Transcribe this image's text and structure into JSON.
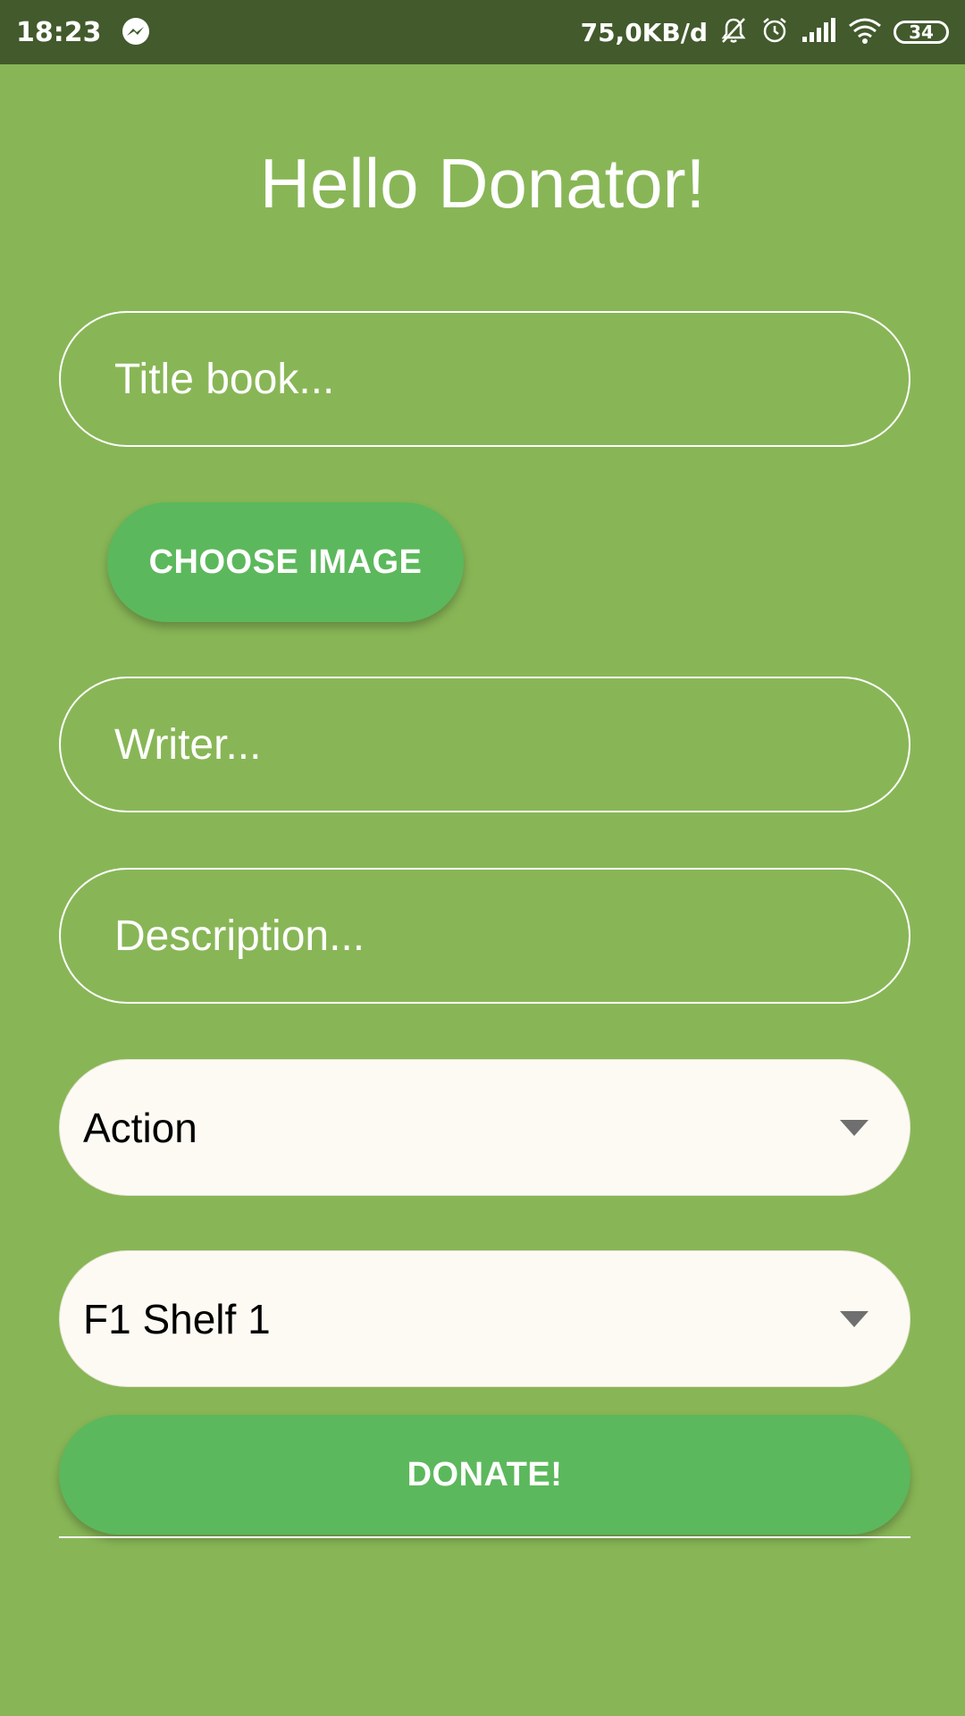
{
  "status_bar": {
    "time": "18:23",
    "net_speed": "75,0KB/d",
    "battery_level": "34",
    "icons": [
      "messenger-icon",
      "mute-icon",
      "alarm-icon",
      "signal-icon",
      "wifi-icon",
      "battery-icon"
    ]
  },
  "header": {
    "title": "Hello Donator!"
  },
  "form": {
    "title_placeholder": "Title book...",
    "choose_image_label": "CHOOSE IMAGE",
    "writer_placeholder": "Writer...",
    "description_placeholder": "Description...",
    "genre_selected": "Action",
    "shelf_selected": "F1 Shelf 1",
    "donate_label": "DONATE!"
  },
  "colors": {
    "background": "#88b656",
    "status_bar": "#425a2c",
    "button": "#5cb85c",
    "select_background": "#fdfaf3",
    "text_light": "#ffffff"
  }
}
